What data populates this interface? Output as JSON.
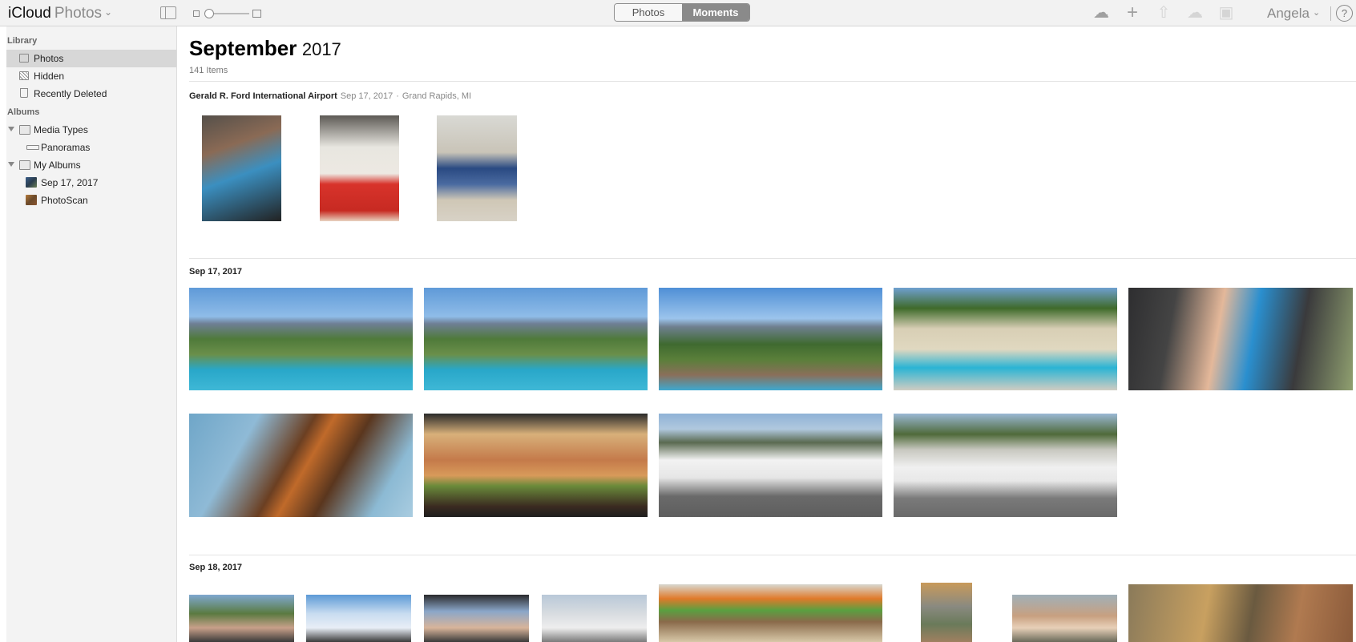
{
  "toolbar": {
    "brand_icloud": "iCloud",
    "brand_app": "Photos",
    "segment_photos": "Photos",
    "segment_moments": "Moments",
    "user_name": "Angela",
    "help": "?",
    "tools": [
      "upload-icon",
      "add-icon",
      "share-icon",
      "download-icon",
      "trash-icon"
    ]
  },
  "sidebar": {
    "library_header": "Library",
    "albums_header": "Albums",
    "library_items": [
      "Photos",
      "Hidden",
      "Recently Deleted"
    ],
    "album_items": [
      "Media Types",
      "Panoramas",
      "My Albums",
      "Sep 17, 2017",
      "PhotoScan"
    ],
    "selected": "Photos"
  },
  "main": {
    "title_month": "September",
    "title_year": "2017",
    "item_count": "141 Items",
    "moments": [
      {
        "location": "Gerald R. Ford International Airport",
        "date": "Sep 17, 2017",
        "separator": "·",
        "place": "Grand Rapids, MI"
      },
      {
        "location": "Sep 17, 2017"
      },
      {
        "location": "Sep 18, 2017"
      }
    ]
  },
  "colors": {
    "toolbar_bg": "#f2f2f2",
    "sidebar_bg": "#f3f3f3",
    "sidebar_selected": "#d7d7d7",
    "segment_active": "#8a8a8a"
  }
}
